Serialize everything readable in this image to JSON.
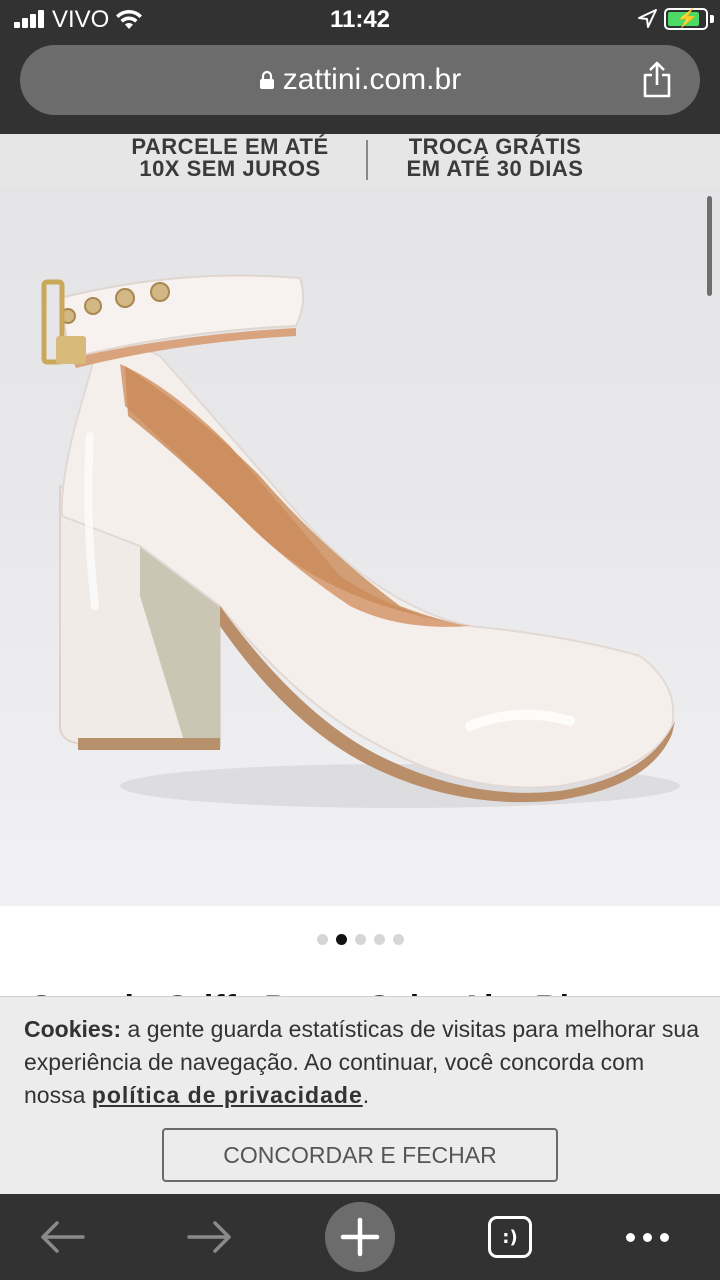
{
  "status_bar": {
    "carrier": "VIVO",
    "time": "11:42",
    "battery_charging": true,
    "battery_level": 0.85,
    "battery_color": "#4cd964"
  },
  "browser": {
    "url": "zattini.com.br",
    "icons": [
      "lock-icon",
      "share-icon"
    ]
  },
  "banner": {
    "item1_line1": "PARCELE EM ATÉ",
    "item1_line2": "10X SEM JUROS",
    "item2_line1": "TROCA GRÁTIS",
    "item2_line2": "EM ATÉ 30 DIAS"
  },
  "carousel": {
    "total": 5,
    "active_index": 1
  },
  "product": {
    "title_partial": "Scarpin Griffe Pump Salto Alto Bl"
  },
  "cookie": {
    "label": "Cookies:",
    "text": " a gente guarda estatísticas de visitas para melhorar sua experiência de navegação. Ao continuar, você concorda com nossa ",
    "link": "política de privacidade",
    "end": ".",
    "button": "CONCORDAR E FECHAR"
  },
  "toolbar": {
    "icons": [
      "back-arrow-icon",
      "forward-arrow-icon",
      "plus-icon",
      "tabs-icon",
      "more-icon"
    ],
    "tabs_label": ":)"
  },
  "colors": {
    "chrome_dark": "#323232",
    "url_bar": "#6c6c6c",
    "cookie_bg": "#ececec"
  }
}
